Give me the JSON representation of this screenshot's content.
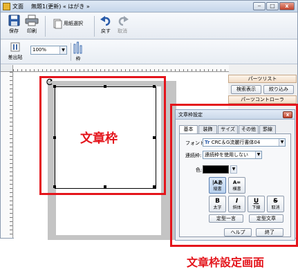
{
  "window": {
    "app_name": "文面",
    "doc_title": "無題1(更新) « はがき »",
    "minimize": "‒",
    "maximize": "□",
    "close": "x"
  },
  "toolbar1": {
    "save": "保存",
    "print": "印刷",
    "paper_select": "用紙選択",
    "undo": "戻す",
    "redo": "取消"
  },
  "toolbar2": {
    "paste": "差出貼",
    "zoom_value": "100%",
    "frame": "枠"
  },
  "parts_list": {
    "title": "パーツリスト",
    "search_display": "検索表示",
    "filter": "絞り込み",
    "control": "パーツコントローラ"
  },
  "dialog": {
    "title": "文章枠設定",
    "close": "x",
    "tabs": [
      "基本",
      "装飾",
      "サイズ",
      "その他",
      "罫線"
    ],
    "font_label": "フォント:",
    "font_value": "CRC＆G流麗行書体04",
    "font_prefix": "Tr",
    "layout_label": "連続枠:",
    "layout_value": "連続枠を使用しない",
    "color_label": "色:",
    "vertical": "縦書",
    "vertical_icon": "|Aあ",
    "horizontal": "横書",
    "horizontal_icon": "A=",
    "bold_glyph": "B",
    "bold": "太字",
    "italic_glyph": "I",
    "italic": "斜体",
    "underline_glyph": "U",
    "underline": "下線",
    "strike_glyph": "S",
    "strike": "取消",
    "fixed_phrase": "定型一言",
    "fixed_text": "定型文章",
    "help": "ヘルプ",
    "done": "終了"
  },
  "annotations": {
    "text_frame": "文章枠",
    "dialog_label": "文章枠設定画面",
    "color": "#e4141b"
  }
}
